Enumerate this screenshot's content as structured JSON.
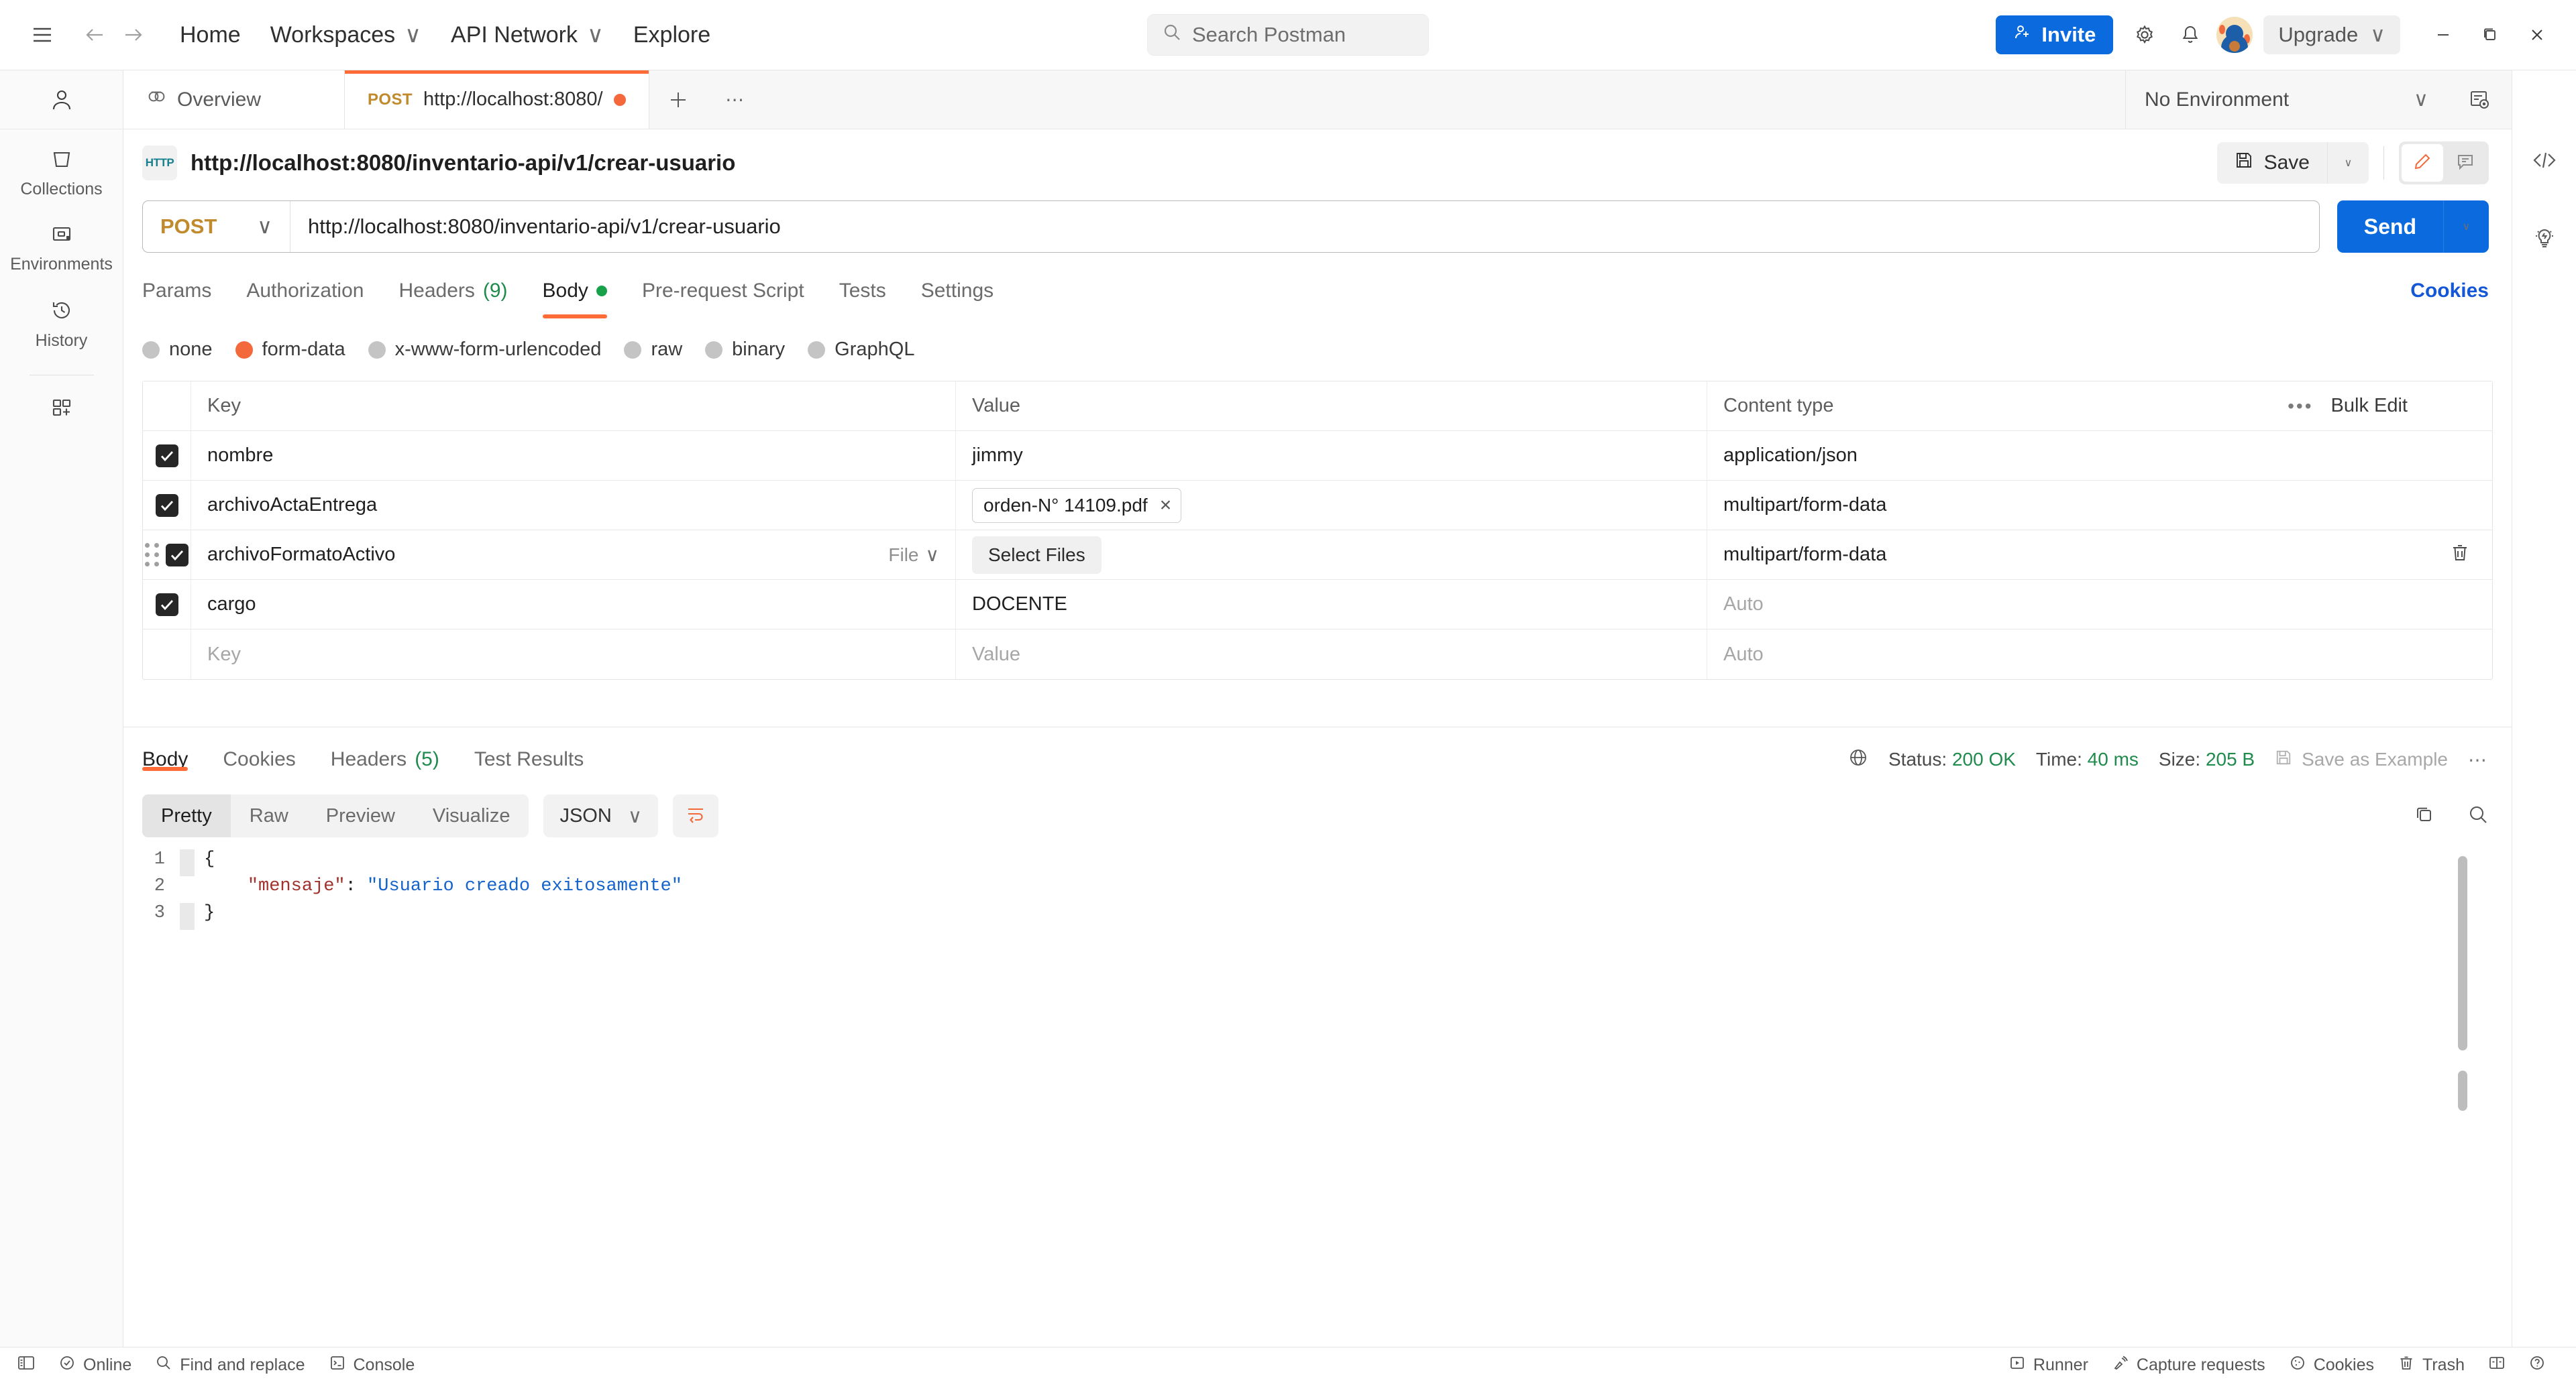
{
  "topbar": {
    "hamburger_icon": "menu-icon",
    "back_icon": "arrow-left-icon",
    "forward_icon": "arrow-right-icon",
    "links": [
      {
        "label": "Home",
        "caret": false
      },
      {
        "label": "Workspaces",
        "caret": true
      },
      {
        "label": "API Network",
        "caret": true
      },
      {
        "label": "Explore",
        "caret": false
      }
    ],
    "search_placeholder": "Search Postman",
    "invite_label": "Invite",
    "upgrade_label": "Upgrade",
    "caret_glyph": "∨"
  },
  "rail": {
    "items": [
      {
        "label": "Collections",
        "icon": "collections-icon"
      },
      {
        "label": "Environments",
        "icon": "environments-icon"
      },
      {
        "label": "History",
        "icon": "history-icon"
      }
    ],
    "new_label": "new-icon"
  },
  "tabs": {
    "overview_label": "Overview",
    "request_verb": "POST",
    "request_title": "http://localhost:8080/",
    "plus_glyph": "+",
    "dots_glyph": "⋯",
    "environment_label": "No Environment",
    "environment_caret": "∨"
  },
  "request": {
    "protocol_badge": "HTTP",
    "title": "http://localhost:8080/inventario-api/v1/crear-usuario",
    "save_label": "Save",
    "save_caret": "∨",
    "method": "POST",
    "method_caret": "∨",
    "url": "http://localhost:8080/inventario-api/v1/crear-usuario",
    "send_label": "Send",
    "send_caret": "∨",
    "tabs": [
      {
        "label": "Params",
        "count": null,
        "dot": false,
        "active": false
      },
      {
        "label": "Authorization",
        "count": null,
        "dot": false,
        "active": false
      },
      {
        "label": "Headers",
        "count": "(9)",
        "dot": false,
        "active": false
      },
      {
        "label": "Body",
        "count": null,
        "dot": true,
        "active": true
      },
      {
        "label": "Pre-request Script",
        "count": null,
        "dot": false,
        "active": false
      },
      {
        "label": "Tests",
        "count": null,
        "dot": false,
        "active": false
      },
      {
        "label": "Settings",
        "count": null,
        "dot": false,
        "active": false
      }
    ],
    "cookies_label": "Cookies",
    "body_types": [
      {
        "label": "none",
        "selected": false
      },
      {
        "label": "form-data",
        "selected": true
      },
      {
        "label": "x-www-form-urlencoded",
        "selected": false
      },
      {
        "label": "raw",
        "selected": false
      },
      {
        "label": "binary",
        "selected": false
      },
      {
        "label": "GraphQL",
        "selected": false
      }
    ]
  },
  "formdata": {
    "headers": {
      "key": "Key",
      "value": "Value",
      "content_type": "Content type"
    },
    "bulk_edit_label": "Bulk Edit",
    "bulk_dots": "•••",
    "file_type_label": "File",
    "file_type_caret": "∨",
    "select_files_label": "Select Files",
    "rows": [
      {
        "checked": true,
        "key": "nombre",
        "value": "jimmy",
        "value_kind": "text",
        "content_type": "application/json",
        "grip": false,
        "delete": false
      },
      {
        "checked": true,
        "key": "archivoActaEntrega",
        "value": "orden-N° 14109.pdf",
        "value_kind": "filechip",
        "content_type": "multipart/form-data",
        "grip": false,
        "delete": false
      },
      {
        "checked": true,
        "key": "archivoFormatoActivo",
        "value": "",
        "value_kind": "selectfiles",
        "content_type": "multipart/form-data",
        "grip": true,
        "delete": true,
        "type_selector": "File"
      },
      {
        "checked": true,
        "key": "cargo",
        "value": "DOCENTE",
        "value_kind": "text",
        "content_type": "",
        "content_type_placeholder": "Auto",
        "grip": false,
        "delete": false
      }
    ],
    "empty_row": {
      "key_placeholder": "Key",
      "value_placeholder": "Value",
      "content_type_placeholder": "Auto"
    }
  },
  "response": {
    "tabs": [
      {
        "label": "Body",
        "count": null,
        "active": true
      },
      {
        "label": "Cookies",
        "count": null,
        "active": false
      },
      {
        "label": "Headers",
        "count": "(5)",
        "active": false
      },
      {
        "label": "Test Results",
        "count": null,
        "active": false
      }
    ],
    "status_label": "Status:",
    "status_value": "200 OK",
    "time_label": "Time:",
    "time_value": "40 ms",
    "size_label": "Size:",
    "size_value": "205 B",
    "save_example_label": "Save as Example",
    "more_dots": "⋯",
    "view_modes": [
      {
        "label": "Pretty",
        "active": true
      },
      {
        "label": "Raw",
        "active": false
      },
      {
        "label": "Preview",
        "active": false
      },
      {
        "label": "Visualize",
        "active": false
      }
    ],
    "format": "JSON",
    "format_caret": "∨",
    "code_lines": [
      {
        "n": "1",
        "fold": true,
        "segments": [
          {
            "t": "{",
            "c": "pun"
          }
        ]
      },
      {
        "n": "2",
        "fold": false,
        "segments": [
          {
            "t": "    ",
            "c": "pun"
          },
          {
            "t": "\"mensaje\"",
            "c": "key"
          },
          {
            "t": ": ",
            "c": "pun"
          },
          {
            "t": "\"Usuario creado exitosamente\"",
            "c": "str"
          }
        ]
      },
      {
        "n": "3",
        "fold": true,
        "segments": [
          {
            "t": "}",
            "c": "pun"
          }
        ]
      }
    ]
  },
  "statusbar": {
    "left": [
      {
        "label": "",
        "icon": "sidebar-toggle-icon"
      },
      {
        "label": "Online",
        "icon": "online-icon"
      },
      {
        "label": "Find and replace",
        "icon": "search-icon"
      },
      {
        "label": "Console",
        "icon": "console-icon"
      }
    ],
    "right": [
      {
        "label": "Runner",
        "icon": "runner-icon"
      },
      {
        "label": "Capture requests",
        "icon": "capture-icon"
      },
      {
        "label": "Cookies",
        "icon": "cookie-icon"
      },
      {
        "label": "Trash",
        "icon": "trash-icon"
      },
      {
        "label": "",
        "icon": "layout-icon"
      },
      {
        "label": "",
        "icon": "help-icon"
      }
    ]
  },
  "colors": {
    "accent_orange": "#ff6c37",
    "accent_blue": "#0b6bde",
    "status_green": "#1f8b4c",
    "method_post": "#c08a2d"
  }
}
